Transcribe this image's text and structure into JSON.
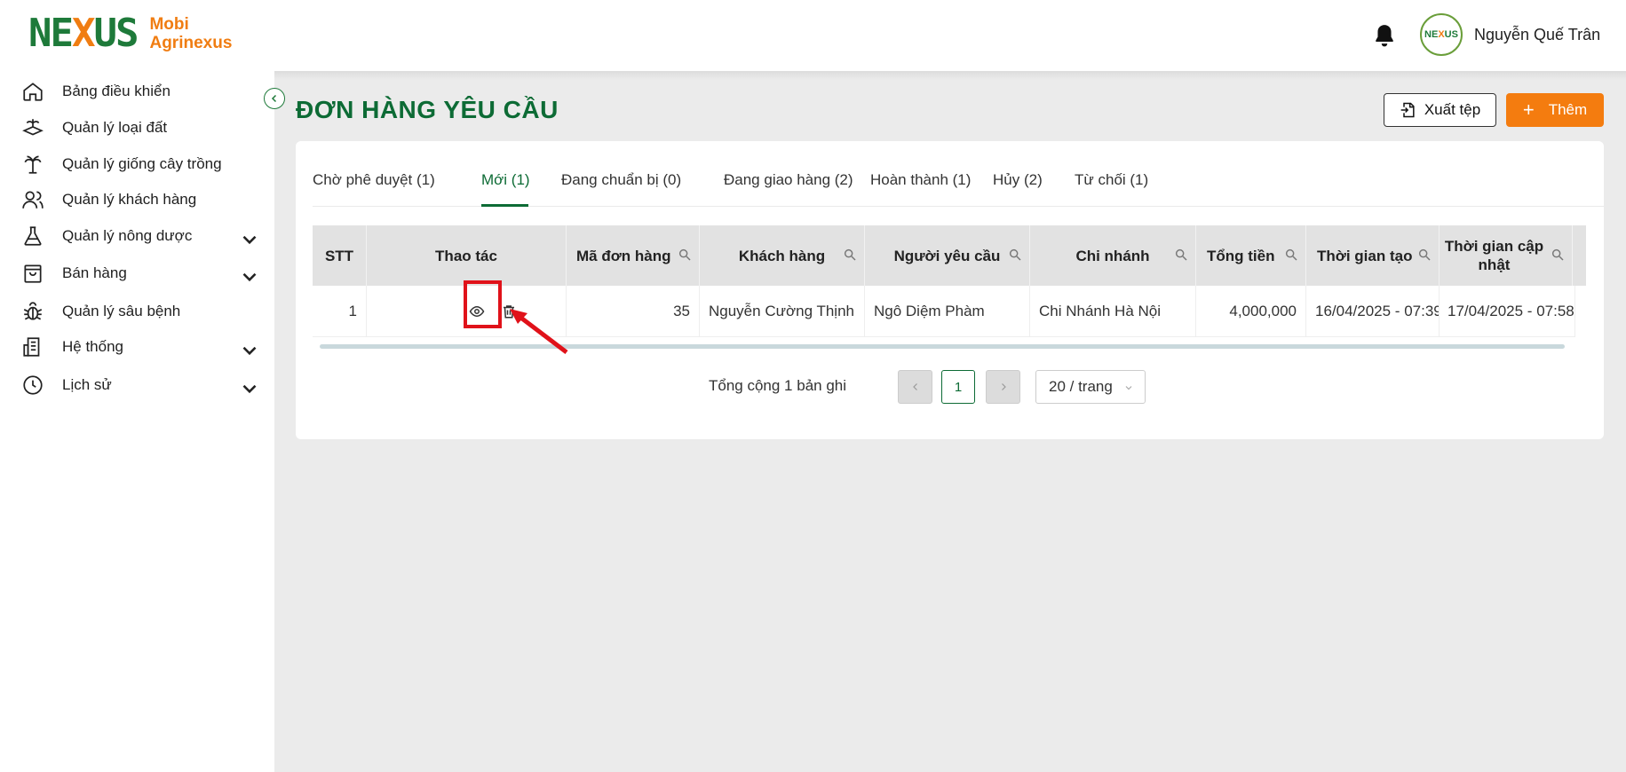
{
  "header": {
    "brand_line1": "Mobi",
    "brand_line2": "Agrinexus",
    "user_name": "Nguyễn Quế Trân",
    "icons": [
      "bell-icon",
      "avatar"
    ]
  },
  "sidebar": {
    "items": [
      {
        "label": "Bảng điều khiển",
        "icon": "home-icon",
        "has_children": false
      },
      {
        "label": "Quản lý loại đất",
        "icon": "soil-icon",
        "has_children": false
      },
      {
        "label": "Quản lý giống cây trồng",
        "icon": "palm-tree-icon",
        "has_children": false
      },
      {
        "label": "Quản lý khách hàng",
        "icon": "users-icon",
        "has_children": false
      },
      {
        "label": "Quản lý nông dược",
        "icon": "flask-icon",
        "has_children": true
      },
      {
        "label": "Bán hàng",
        "icon": "shopping-bag-icon",
        "has_children": true
      },
      {
        "label": "Quản lý sâu bệnh",
        "icon": "bug-icon",
        "has_children": false
      },
      {
        "label": "Hệ thống",
        "icon": "building-icon",
        "has_children": true
      },
      {
        "label": "Lịch sử",
        "icon": "clock-icon",
        "has_children": true
      }
    ]
  },
  "main": {
    "title": "ĐƠN HÀNG YÊU CẦU",
    "export_label": "Xuất tệp",
    "add_label": "Thêm",
    "tabs": [
      {
        "label": "Chờ phê duyệt (1)",
        "active": false
      },
      {
        "label": "Mới (1)",
        "active": true
      },
      {
        "label": "Đang chuẩn bị (0)",
        "active": false
      },
      {
        "label": "Đang giao hàng (2)",
        "active": false
      },
      {
        "label": "Hoàn thành (1)",
        "active": false
      },
      {
        "label": "Hủy (2)",
        "active": false
      },
      {
        "label": "Từ chối (1)",
        "active": false
      }
    ],
    "table": {
      "columns": [
        "STT",
        "Thao tác",
        "Mã đơn hàng",
        "Khách hàng",
        "Người yêu cầu",
        "Chi nhánh",
        "Tổng tiền",
        "Thời gian tạo",
        "Thời gian cập nhật"
      ],
      "rows": [
        [
          "1",
          "",
          "35",
          "Nguyễn Cường Thịnh",
          "Ngô Diệm Phàm",
          "Chi Nhánh Hà Nội",
          "4,000,000",
          "16/04/2025 - 07:39",
          "17/04/2025 - 07:58"
        ]
      ]
    },
    "pagination": {
      "total_text": "Tổng cộng 1 bản ghi",
      "current_page": "1",
      "page_size": "20 / trang"
    }
  },
  "colors": {
    "brand_green": "#0d6b35",
    "brand_orange": "#f47c0f",
    "highlight_red": "#e0121a"
  }
}
